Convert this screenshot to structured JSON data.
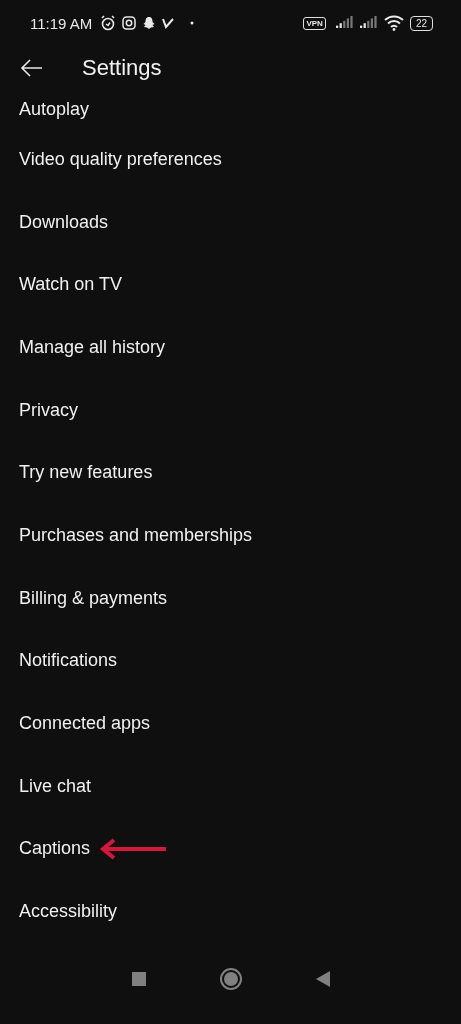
{
  "status_bar": {
    "time": "11:19 AM",
    "vpn": "VPN",
    "battery": "22"
  },
  "header": {
    "title": "Settings"
  },
  "items": [
    {
      "label": "Autoplay",
      "annotated": false
    },
    {
      "label": "Video quality preferences",
      "annotated": false
    },
    {
      "label": "Downloads",
      "annotated": false
    },
    {
      "label": "Watch on TV",
      "annotated": false
    },
    {
      "label": "Manage all history",
      "annotated": false
    },
    {
      "label": "Privacy",
      "annotated": false
    },
    {
      "label": "Try new features",
      "annotated": false
    },
    {
      "label": "Purchases and memberships",
      "annotated": false
    },
    {
      "label": "Billing & payments",
      "annotated": false
    },
    {
      "label": "Notifications",
      "annotated": false
    },
    {
      "label": "Connected apps",
      "annotated": false
    },
    {
      "label": "Live chat",
      "annotated": false
    },
    {
      "label": "Captions",
      "annotated": true
    },
    {
      "label": "Accessibility",
      "annotated": false
    }
  ]
}
